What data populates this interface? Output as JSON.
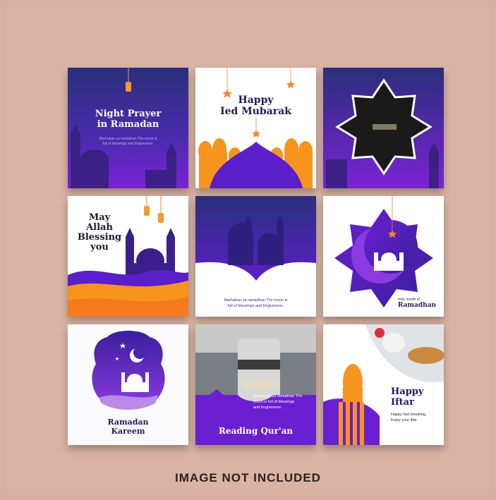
{
  "cards": {
    "night_prayer": {
      "title_line1": "Night Prayer",
      "title_line2": "in Ramadan",
      "body_line1": "Marhaban ya ramadhan The moon is",
      "body_line2": "full of blessings and forgiveness."
    },
    "eid_mubarak": {
      "title_line1": "Happy",
      "title_line2": "Ied Mubarak"
    },
    "allah_bless": {
      "line1": "May",
      "line2": "Allah",
      "line3": "Blessing",
      "line4": "you"
    },
    "marhaban": {
      "body_line1": "Marhaban ya ramadhan The moon is",
      "body_line2": "full of blessings and forgiveness."
    },
    "holy_month": {
      "small": "Holy month of",
      "title": "Ramadhan"
    },
    "ramadan_kareem": {
      "line1": "Ramadan",
      "line2": "Kareem"
    },
    "reading_quran": {
      "body_line1": "Marhaban ya ramadhan The",
      "body_line2": "moon is full of blessings",
      "body_line3": "and forgiveness.",
      "title": "Reading Qur'an"
    },
    "happy_iftar": {
      "title_line1": "Happy",
      "title_line2": "Iftar",
      "body_line1": "Happy fast breaking,",
      "body_line2": "Enjoy your Iftar"
    }
  },
  "footer": {
    "caption": "IMAGE NOT INCLUDED"
  },
  "colors": {
    "background": "#d9b3a3",
    "purple_dark": "#3a1f9c",
    "purple": "#6a1fd1",
    "orange": "#f57b1e",
    "ink": "#25195a"
  }
}
